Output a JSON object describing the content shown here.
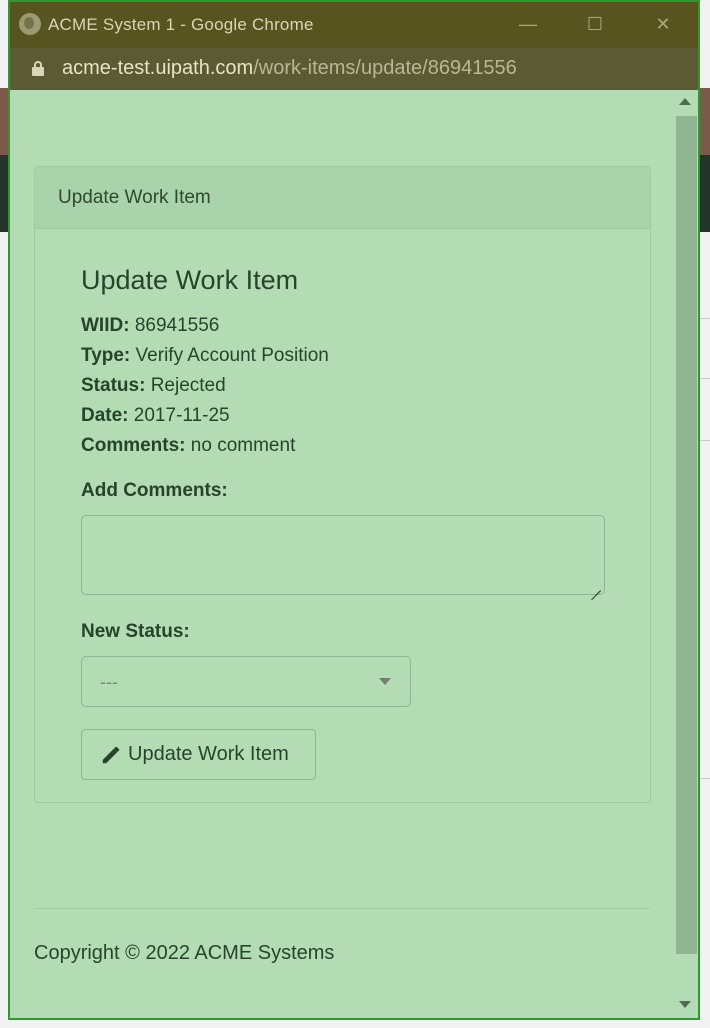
{
  "window": {
    "title": "ACME System 1 - Google Chrome",
    "minimize": "—",
    "maximize": "☐",
    "close": "✕"
  },
  "address": {
    "domain": "acme-test.uipath.com",
    "path": "/work-items/update/86941556"
  },
  "panel": {
    "heading": "Update Work Item",
    "title": "Update Work Item",
    "fields": [
      {
        "label": "WIID:",
        "value": "86941556"
      },
      {
        "label": "Type:",
        "value": "Verify Account Position"
      },
      {
        "label": "Status:",
        "value": "Rejected"
      },
      {
        "label": "Date:",
        "value": "2017-11-25"
      },
      {
        "label": "Comments:",
        "value": "no comment"
      }
    ],
    "add_comments_label": "Add Comments:",
    "add_comments_value": "",
    "new_status_label": "New Status:",
    "new_status_selected": "---",
    "submit_label": "Update Work Item"
  },
  "footer": {
    "copyright": "Copyright © 2022 ACME Systems"
  },
  "icons": {
    "site": "globe-icon",
    "lock": "lock-icon",
    "submit": "pencil-icon",
    "select": "chevron-down-icon"
  },
  "colors": {
    "overlay_green": "#b3dcb5",
    "titlebar": "#57541f",
    "border": "#2e9a2e"
  }
}
